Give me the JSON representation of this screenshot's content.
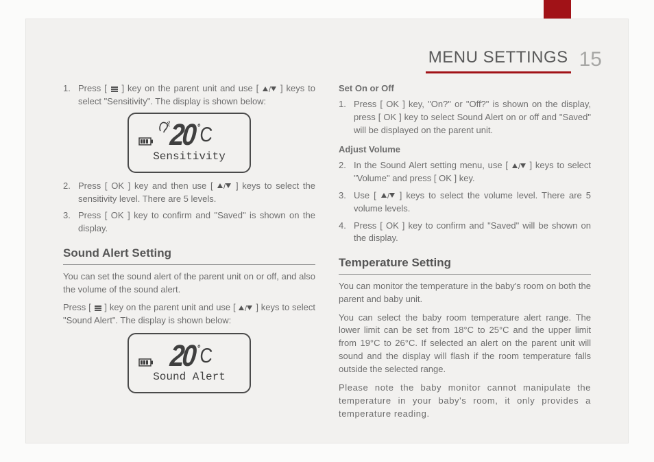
{
  "header": {
    "title": "MENU SETTINGS",
    "page": "15"
  },
  "col1": {
    "step1_a": "Press [ ",
    "step1_b": " ] key on the parent unit and use [ ",
    "step1_c": " ] keys to select \"Sensitivity\". The display is shown below:",
    "lcd1_temp": "20",
    "lcd1_label": "Sensitivity",
    "step2_a": "Press [ OK ] key and then use [ ",
    "step2_b": " ] keys to select the sensitivity level. There are 5 levels.",
    "step3": "Press [ OK ] key to confirm and \"Saved\" is shown on the display.",
    "h_sound": "Sound Alert Setting",
    "p_sound1": "You can set the sound alert of the parent unit on or off, and also the volume of the sound alert.",
    "p_sound2_a": "Press [ ",
    "p_sound2_b": " ] key on the parent unit and use [ ",
    "p_sound2_c": " ] keys to select \"Sound Alert\". The display is shown below:",
    "lcd2_temp": "20",
    "lcd2_label": "Sound Alert"
  },
  "col2": {
    "h_onoff": "Set On or Off",
    "step_o1": "Press [ OK ] key, \"On?\" or \"Off?\" is shown on the display, press [ OK ] key to select Sound Alert on or off and \"Saved\" will be displayed on the parent unit.",
    "h_vol": "Adjust Volume",
    "step_v2_a": "In the Sound Alert setting menu, use [ ",
    "step_v2_b": " ] keys to select \"Volume\" and press [ OK ] key.",
    "step_v3_a": "Use [ ",
    "step_v3_b": " ] keys to select the volume level. There are 5 volume levels.",
    "step_v4": "Press [ OK ] key to confirm and \"Saved\" will be shown on the display.",
    "h_temp": "Temperature Setting",
    "p_temp1": "You can monitor the temperature in the baby's room on both the parent and baby unit.",
    "p_temp2": "You can select the baby room temperature alert range. The lower limit can be set from 18°C to 25°C and the upper limit from 19°C to 26°C. If selected an alert on the parent unit will sound and the display will flash if the room temperature falls outside the selected range.",
    "p_temp3": "Please note the baby monitor cannot manipulate the temperature in your baby's room, it only provides a temperature reading."
  }
}
